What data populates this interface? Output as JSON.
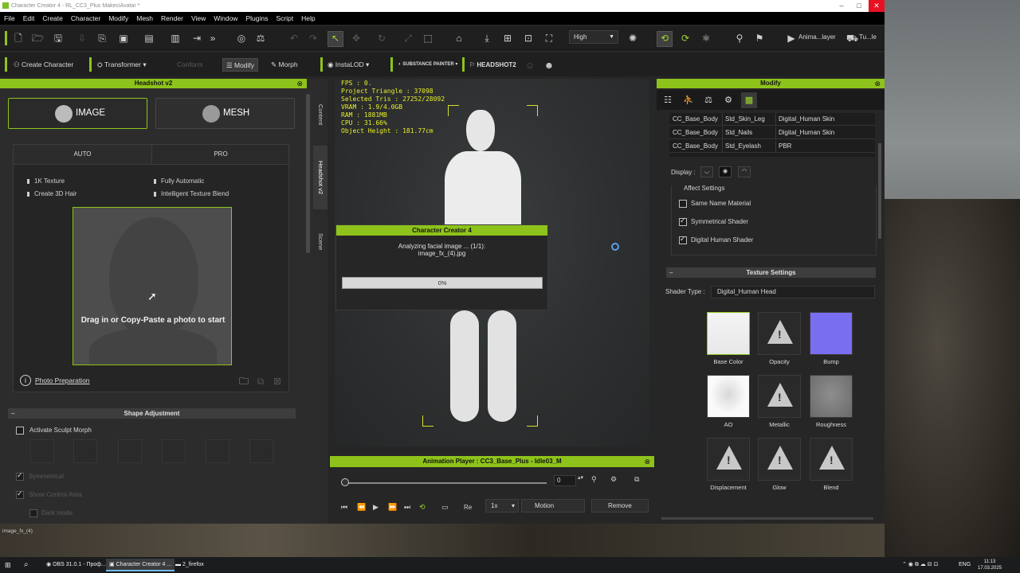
{
  "window": {
    "title": "Character Creator 4 - RL_CC3_Plus MakeciAvatar *"
  },
  "menu": [
    "File",
    "Edit",
    "Create",
    "Character",
    "Modify",
    "Mesh",
    "Render",
    "View",
    "Window",
    "Plugins",
    "Script",
    "Help"
  ],
  "toolbar1": {
    "quality": "High",
    "anim_label": "Anima...layer",
    "tool_label": "Tu...le"
  },
  "toolbar2": {
    "create_character": "Create Character",
    "transformer": "Transformer",
    "conform": "Conform",
    "modify": "Modify",
    "morph": "Morph",
    "instalod": "InstaLOD",
    "substance": "SUBSTANCE PAINTER",
    "headshot2": "HEADSHOT2"
  },
  "headshot": {
    "title": "Headshot v2",
    "image_label": "IMAGE",
    "mesh_label": "MESH",
    "tab_auto": "AUTO",
    "tab_pro": "PRO",
    "features": [
      "1K Texture",
      "Fully Automatic",
      "Create 3D Hair",
      "Intelligent Texture Blend"
    ],
    "drop_text": "Drag in or Copy-Paste a photo to start",
    "photo_prep": "Photo Preparation",
    "shape_adjustment": "Shape Adjustment",
    "activate_sculpt": "Activate Sculpt Morph",
    "symmetrical": "Symmetrical",
    "show_control_area": "Show Control Area",
    "dark_mode": "Dark mode"
  },
  "sidetabs": [
    "Content",
    "Headshot v2",
    "Scene"
  ],
  "viewport": {
    "stats": [
      "FPS : 0.",
      "Project Triangle : 37098",
      "Selected Tris : 27252/28092",
      "VRAM : 1.9/4.0GB",
      "RAM : 1881MB",
      "CPU : 31.66%",
      "Object Height : 181.77cm"
    ]
  },
  "dialog": {
    "title": "Character Creator 4",
    "line1": "Analyzing facial image ... (1/1):",
    "line2": "image_fx_(4).jpg",
    "progress_label": "0%",
    "progress": 0
  },
  "animation_player": {
    "title": "Animation Player : CC3_Base_Plus - Idle03_M",
    "frame": "0",
    "re_label": "Re",
    "speed": "1x",
    "motion": "Motion",
    "remove": "Remove"
  },
  "modify": {
    "title": "Modify",
    "materials": [
      {
        "object": "CC_Base_Body",
        "material": "Std_Skin_Leg",
        "shader": "Digital_Human Skin"
      },
      {
        "object": "CC_Base_Body",
        "material": "Std_Nails",
        "shader": "Digital_Human Skin"
      },
      {
        "object": "CC_Base_Body",
        "material": "Std_Eyelash",
        "shader": "PBR"
      }
    ],
    "display_label": "Display :",
    "affect_settings": "Affect Settings",
    "same_name_material": "Same Name Material",
    "symmetrical_shader": "Symmetrical Shader",
    "digital_human_shader": "Digital Human Shader",
    "texture_settings": "Texture Settings",
    "shader_type_label": "Shader Type :",
    "shader_type": "Digital_Human Head",
    "textures": [
      "Base Color",
      "Opacity",
      "Bump",
      "AO",
      "Metallic",
      "Roughness",
      "Displacement",
      "Glow",
      "Blend"
    ]
  },
  "status": {
    "left_text": "image_fx_(4)"
  },
  "taskbar": {
    "obs": "OBS 31.0.1 - Проф...",
    "cc4": "Character Creator 4 ...",
    "firefox": "2_firefox",
    "lang": "ENG",
    "time": "11:13",
    "date": "17.03.2025"
  },
  "colors": {
    "accent": "#8ec31b",
    "hud_text": "#e7ef2a",
    "background": "#262626"
  }
}
